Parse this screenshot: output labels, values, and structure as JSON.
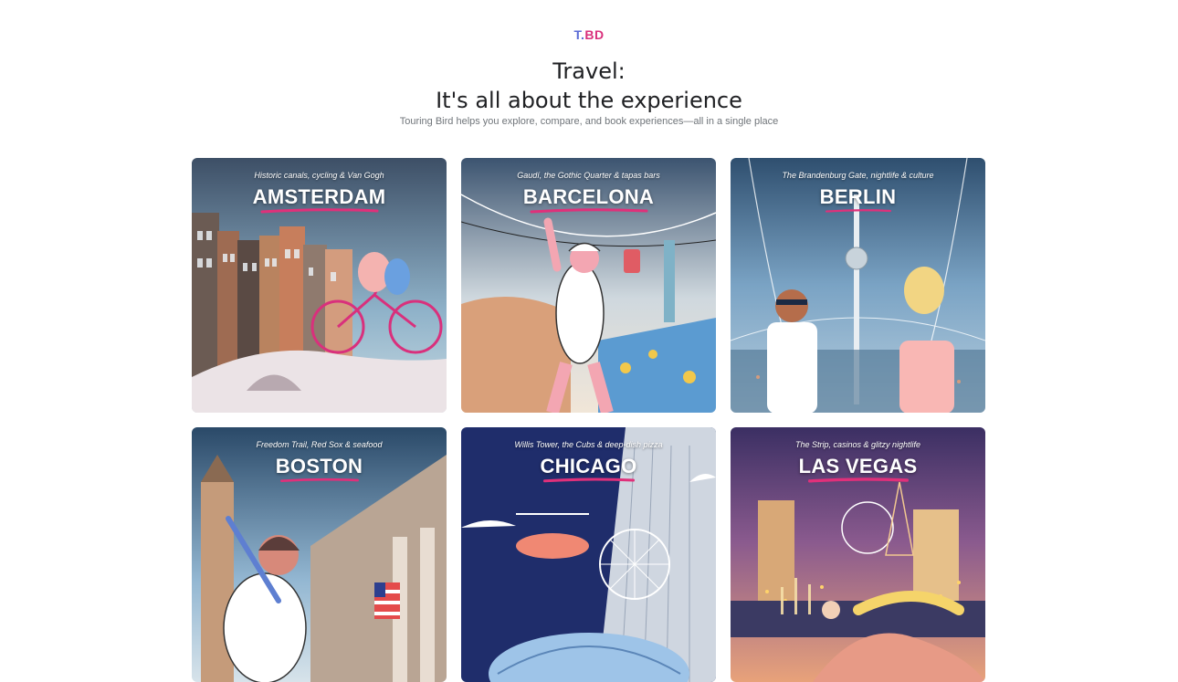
{
  "logo": {
    "t": "T.",
    "bd": "BD"
  },
  "header": {
    "title_line1": "Travel:",
    "title_line2": "It's all about the experience",
    "subtitle": "Touring Bird helps you explore, compare, and book experiences—all in a single place"
  },
  "colors": {
    "logo_blue": "#5b6bd6",
    "accent_pink": "#e0307a",
    "subtitle_gray": "#70757a"
  },
  "cards": [
    {
      "city": "AMSTERDAM",
      "tagline": "Historic canals, cycling & Van Gogh"
    },
    {
      "city": "BARCELONA",
      "tagline": "Gaudí, the Gothic Quarter & tapas bars"
    },
    {
      "city": "BERLIN",
      "tagline": "The Brandenburg Gate, nightlife & culture"
    },
    {
      "city": "BOSTON",
      "tagline": "Freedom Trail, Red Sox & seafood"
    },
    {
      "city": "CHICAGO",
      "tagline": "Willis Tower, the Cubs & deep-dish pizza"
    },
    {
      "city": "LAS VEGAS",
      "tagline": "The Strip, casinos & glitzy nightlife"
    }
  ]
}
